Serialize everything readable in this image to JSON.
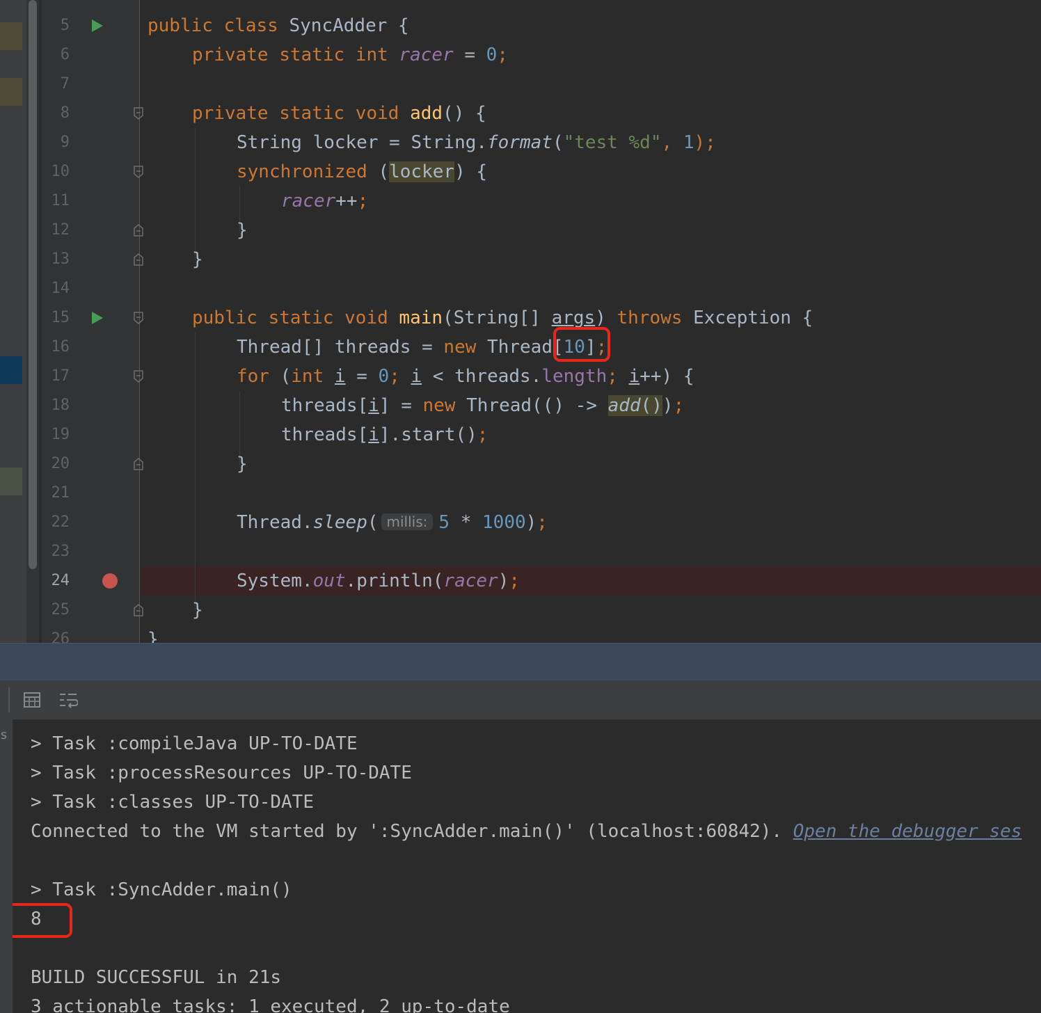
{
  "editor": {
    "line_numbers": [
      "5",
      "6",
      "7",
      "8",
      "9",
      "10",
      "11",
      "12",
      "13",
      "14",
      "15",
      "16",
      "17",
      "18",
      "19",
      "20",
      "21",
      "22",
      "23",
      "24",
      "25",
      "26"
    ],
    "current_line": "24",
    "code": {
      "l5": {
        "a": "public class ",
        "b": "SyncAdder {"
      },
      "l6": {
        "a": "private static int ",
        "b": "racer",
        "c": " = ",
        "d": "0",
        ";": ";"
      },
      "l8": {
        "a": "private static void ",
        "b": "add",
        "c": "() {"
      },
      "l9": {
        "a": "String locker = String.",
        "b": "format",
        "c": "(",
        "d": "\"test %d\"",
        "e": ", ",
        "f": "1",
        "g": ");"
      },
      "l10": {
        "a": "synchronized ",
        "b": "(",
        "c": "locker",
        "d": ") {"
      },
      "l11": {
        "a": "racer",
        "b": "++",
        ";": ";"
      },
      "l12": {
        "a": "}"
      },
      "l13": {
        "a": "}"
      },
      "l15": {
        "a": "public static void ",
        "b": "main",
        "c": "(String[] ",
        "d": "args",
        "e": ") ",
        "f": "throws ",
        "g": "Exception {"
      },
      "l16": {
        "a": "Thread[] threads = ",
        "b": "new ",
        "c": "Thread",
        "d": "[",
        "e": "10",
        "f": "]",
        ";": ";"
      },
      "l17": {
        "a": "for ",
        "b": "(",
        "c": "int ",
        "d": "i",
        "e": " = ",
        "f": "0",
        "g": "; ",
        "h": "i",
        "i2": " < threads.",
        "j": "length",
        "k": "; ",
        "l": "i",
        "m": "++) {"
      },
      "l18": {
        "a": "threads[",
        "b": "i",
        "c": "] = ",
        "d": "new ",
        "e": "Thread(() -> ",
        "f": "add",
        "g": "()",
        ")": ")",
        ";": ";"
      },
      "l19": {
        "a": "threads[",
        "b": "i",
        "c": "].start()",
        ";": ";"
      },
      "l20": {
        "a": "}"
      },
      "l22": {
        "a": "Thread.",
        "b": "sleep",
        "c": "(",
        "hint": "millis:",
        "d": "5",
        "e": " * ",
        "f": "1000",
        "g": ")",
        ";": ";"
      },
      "l24": {
        "a": "System.",
        "b": "out",
        "c": ".println(",
        "d": "racer",
        "e": ")",
        ";": ";"
      },
      "l25": {
        "a": "}"
      },
      "l26": {
        "a": "}"
      }
    }
  },
  "console": {
    "side_label": "s",
    "lines": [
      "> Task :compileJava UP-TO-DATE",
      "> Task :processResources UP-TO-DATE",
      "> Task :classes UP-TO-DATE",
      "Connected to the VM started by ':SyncAdder.main()' (localhost:60842). ",
      "",
      "> Task :SyncAdder.main()",
      "8",
      "",
      "BUILD SUCCESSFUL in 21s",
      "3 actionable tasks: 1 executed, 2 up-to-date"
    ],
    "link_text": "Open the debugger ses"
  },
  "colors": {
    "keyword": "#cc7832",
    "function": "#ffc66d",
    "static_field": "#9876aa",
    "number": "#6897bb",
    "string": "#6a8759",
    "breakpoint": "#c75450",
    "run_marker": "#499c54",
    "annotation_box": "#e8261a"
  },
  "icons": [
    "run-icon",
    "breakpoint-icon",
    "fold-icon",
    "table-icon",
    "soft-wrap-icon"
  ]
}
